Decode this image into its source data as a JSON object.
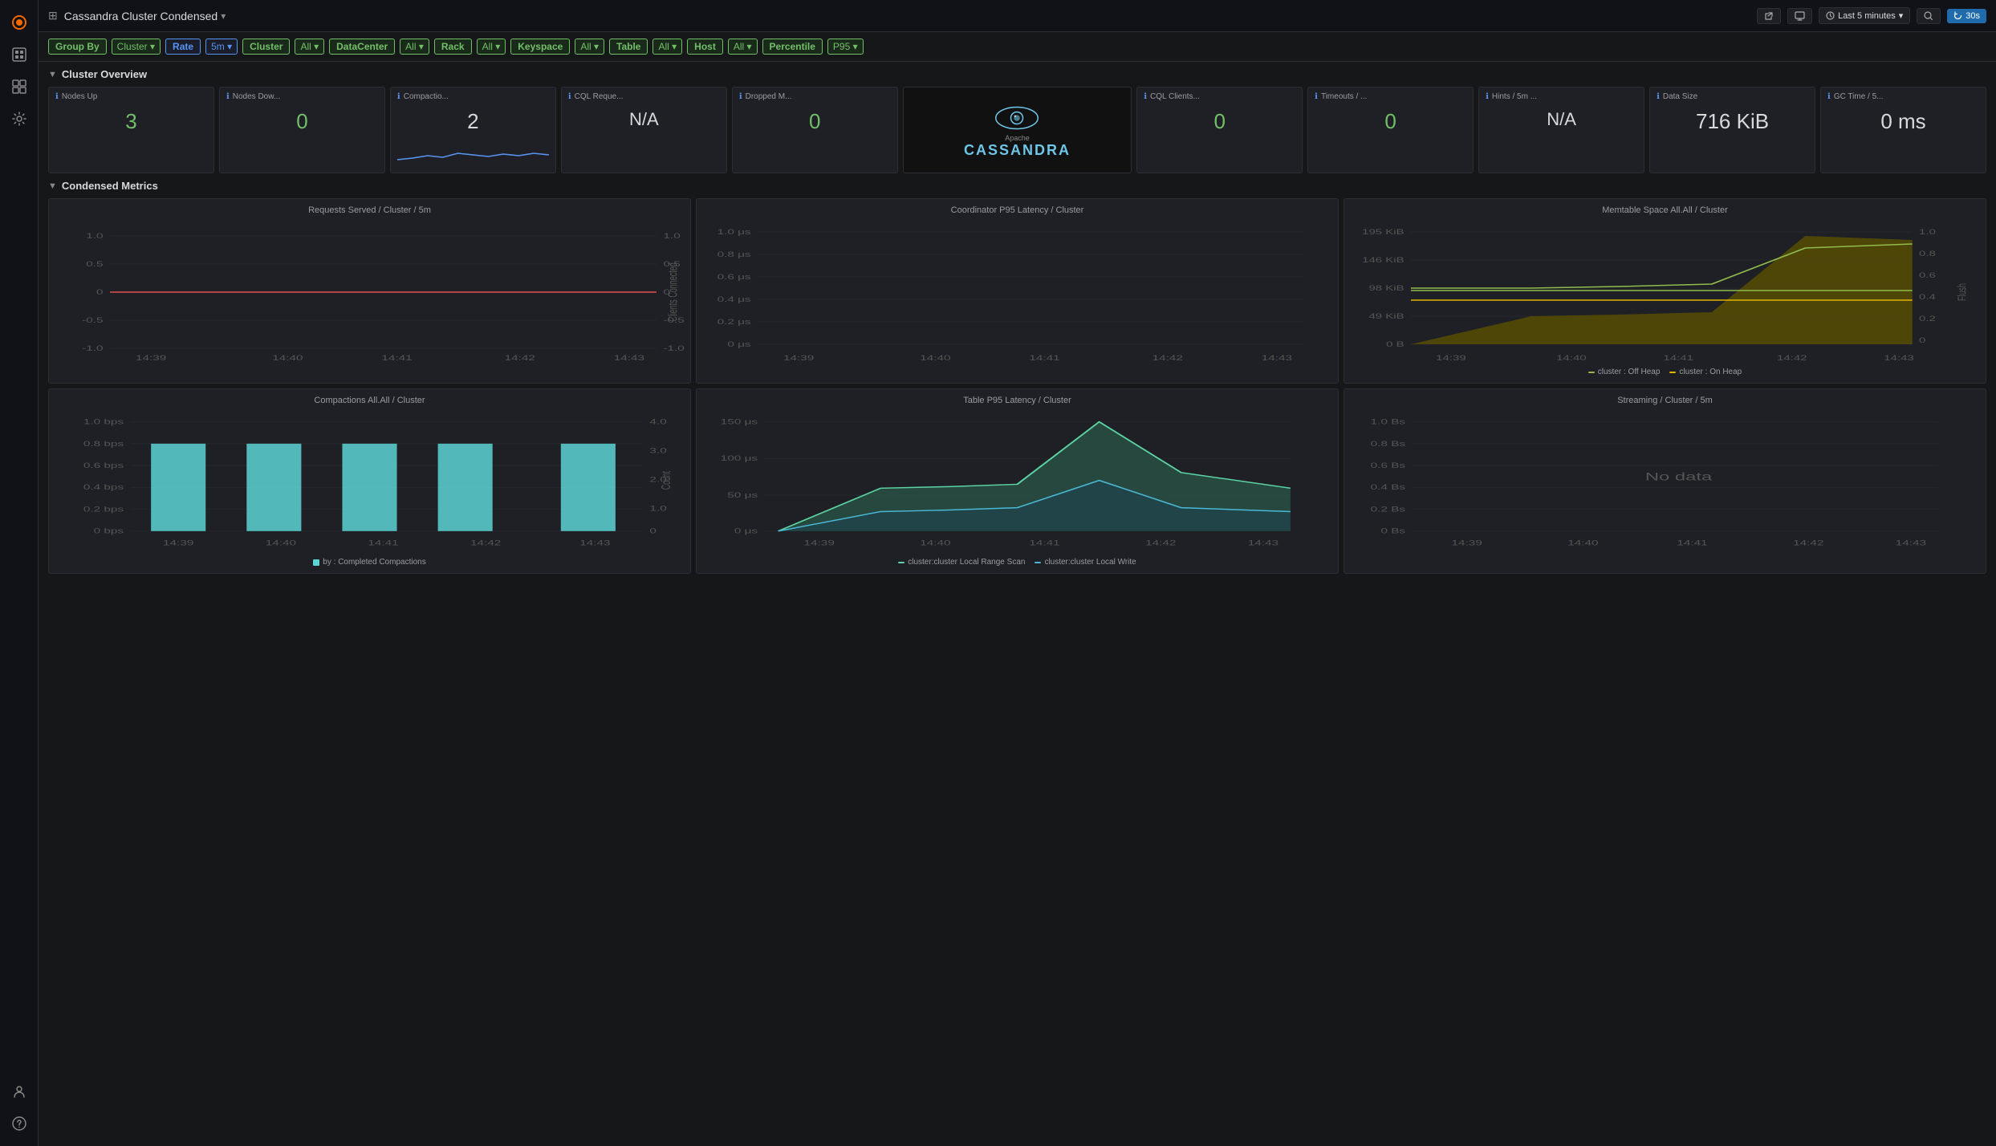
{
  "app": {
    "title": "Cassandra Cluster Condensed",
    "logo_symbol": "◈"
  },
  "topbar": {
    "title": "Cassandra Cluster Condensed",
    "share_label": "Share",
    "tv_label": "TV",
    "time_label": "Last 5 minutes",
    "search_label": "🔍",
    "refresh_label": "30s",
    "chevron": "▾"
  },
  "filters": {
    "group_by_label": "Group By",
    "cluster_label": "Cluster",
    "cluster_val": "Cluster ▾",
    "rate_label": "Rate",
    "rate_val": "5m ▾",
    "cluster_filter_label": "Cluster",
    "cluster_filter_val": "All ▾",
    "dc_label": "DataCenter",
    "dc_val": "All ▾",
    "rack_label": "Rack",
    "rack_val": "All ▾",
    "keyspace_label": "Keyspace",
    "keyspace_val": "All ▾",
    "table_label": "Table",
    "table_val": "All ▾",
    "host_label": "Host",
    "host_val": "All ▾",
    "percentile_label": "Percentile",
    "percentile_val": "P95 ▾"
  },
  "cluster_overview": {
    "title": "Cluster Overview",
    "cards": [
      {
        "id": "nodes-up",
        "title": "Nodes Up",
        "value": "3",
        "color": "green",
        "has_sparkline": false
      },
      {
        "id": "nodes-down",
        "title": "Nodes Dow...",
        "value": "0",
        "color": "green",
        "has_sparkline": false
      },
      {
        "id": "compaction",
        "title": "Compactio...",
        "value": "2",
        "color": "white",
        "has_sparkline": true
      },
      {
        "id": "cql-requests",
        "title": "CQL Reque...",
        "value": "N/A",
        "color": "na",
        "has_sparkline": false
      },
      {
        "id": "dropped-msgs",
        "title": "Dropped M...",
        "value": "0",
        "color": "green",
        "has_sparkline": false
      },
      {
        "id": "cassandra-logo",
        "title": "",
        "value": "",
        "color": "",
        "has_sparkline": false,
        "is_logo": true
      },
      {
        "id": "cql-clients",
        "title": "CQL Clients...",
        "value": "0",
        "color": "green",
        "has_sparkline": false
      },
      {
        "id": "timeouts",
        "title": "Timeouts / ...",
        "value": "0",
        "color": "green",
        "has_sparkline": false
      },
      {
        "id": "hints",
        "title": "Hints / 5m ...",
        "value": "N/A",
        "color": "na",
        "has_sparkline": false
      },
      {
        "id": "data-size",
        "title": "Data Size",
        "value": "716 KiB",
        "color": "white",
        "has_sparkline": false
      },
      {
        "id": "gc-time",
        "title": "GC Time / 5...",
        "value": "0 ms",
        "color": "white",
        "has_sparkline": false
      }
    ]
  },
  "condensed_metrics": {
    "title": "Condensed Metrics",
    "charts": [
      {
        "id": "requests-served",
        "title": "Requests Served / Cluster / 5m",
        "has_data": true,
        "y_axis": [
          "1.0",
          "0.5",
          "0",
          "-0.5",
          "-1.0"
        ],
        "y_axis_right": [
          "1.0",
          "0.5",
          "0",
          "-0.5",
          "-1.0"
        ],
        "y_right_label": "Clients Connected",
        "x_axis": [
          "14:39",
          "14:40",
          "14:41",
          "14:42",
          "14:43"
        ]
      },
      {
        "id": "coordinator-latency",
        "title": "Coordinator P95 Latency / Cluster",
        "has_data": true,
        "y_axis": [
          "1.0 μs",
          "0.8 μs",
          "0.6 μs",
          "0.4 μs",
          "0.2 μs",
          "0 μs"
        ],
        "x_axis": [
          "14:39",
          "14:40",
          "14:41",
          "14:42",
          "14:43"
        ]
      },
      {
        "id": "memtable-space",
        "title": "Memtable Space All.All / Cluster",
        "has_data": true,
        "y_axis": [
          "195 KiB",
          "146 KiB",
          "98 KiB",
          "49 KiB",
          "0 B"
        ],
        "y_axis_right": [
          "1.0",
          "0.8",
          "0.6",
          "0.4",
          "0.2",
          "0"
        ],
        "y_right_label": "Flush",
        "x_axis": [
          "14:39",
          "14:40",
          "14:41",
          "14:42",
          "14:43"
        ],
        "legend": [
          {
            "label": "cluster : Off Heap",
            "color": "#8fbc4c"
          },
          {
            "label": "cluster : On Heap",
            "color": "#e0b400"
          }
        ]
      },
      {
        "id": "compactions",
        "title": "Compactions All.All / Cluster",
        "has_data": true,
        "y_axis": [
          "1.0 bps",
          "0.8 bps",
          "0.6 bps",
          "0.4 bps",
          "0.2 bps",
          "0 bps"
        ],
        "y_axis_right": [
          "4.0",
          "3.0",
          "2.0",
          "1.0",
          "0"
        ],
        "y_right_label": "Count",
        "x_axis": [
          "14:39",
          "14:40",
          "14:41",
          "14:42",
          "14:43"
        ],
        "legend": [
          {
            "label": "by : Completed Compactions",
            "color": "#5cd4d4"
          }
        ]
      },
      {
        "id": "table-latency",
        "title": "Table P95 Latency / Cluster",
        "has_data": true,
        "y_axis": [
          "150 μs",
          "100 μs",
          "50 μs",
          "0 μs"
        ],
        "x_axis": [
          "14:39",
          "14:40",
          "14:41",
          "14:42",
          "14:43"
        ],
        "legend": [
          {
            "label": "cluster:cluster Local Range Scan",
            "color": "#5cd4a4"
          },
          {
            "label": "cluster:cluster Local Write",
            "color": "#4ab8d4"
          }
        ]
      },
      {
        "id": "streaming",
        "title": "Streaming / Cluster / 5m",
        "has_data": false,
        "y_axis": [
          "1.0 Bs",
          "0.8 Bs",
          "0.6 Bs",
          "0.4 Bs",
          "0.2 Bs",
          "0 Bs"
        ],
        "x_axis": [
          "14:39",
          "14:40",
          "14:41",
          "14:42",
          "14:43"
        ],
        "no_data_label": "No data"
      }
    ]
  },
  "sidebar": {
    "icons": [
      {
        "id": "logo",
        "symbol": "🔥",
        "active": true
      },
      {
        "id": "search",
        "symbol": "⊞"
      },
      {
        "id": "grid",
        "symbol": "⊟"
      },
      {
        "id": "settings",
        "symbol": "⚙"
      }
    ],
    "bottom_icons": [
      {
        "id": "user",
        "symbol": "⎋"
      },
      {
        "id": "help",
        "symbol": "?"
      }
    ]
  }
}
